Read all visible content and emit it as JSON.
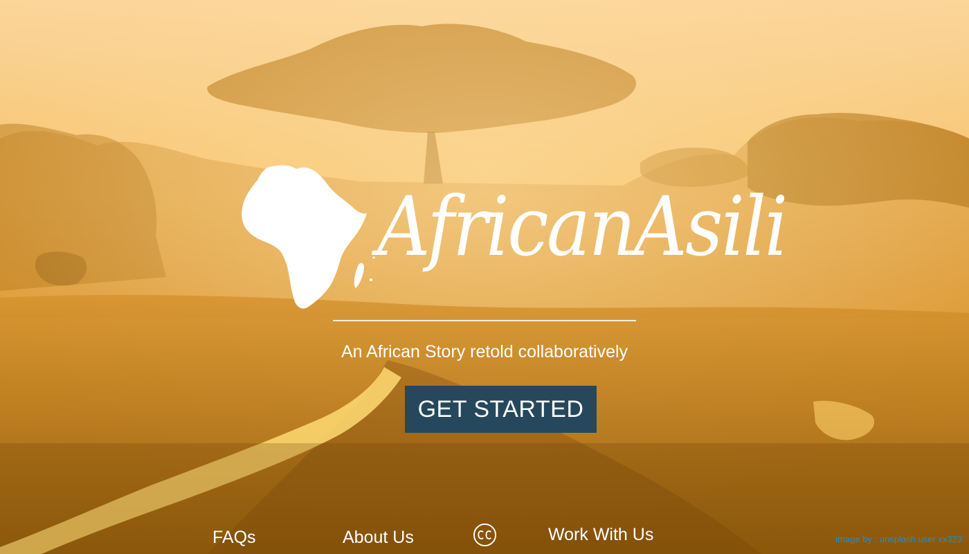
{
  "brand": {
    "name": "AfricanAsili",
    "logo_icon": "africa-map-icon"
  },
  "hero": {
    "tagline": "An African Story retold collaboratively",
    "cta_label": "GET STARTED",
    "background": "african-savanna-sunset-photo"
  },
  "footer": {
    "links": [
      {
        "label": "FAQs"
      },
      {
        "label": "About Us"
      },
      {
        "label": "Work With Us"
      }
    ],
    "license_icon": "creative-commons-icon",
    "credit": "image by : unsplash user xx323"
  },
  "colors": {
    "cta_background": "#26485c",
    "text": "#ffffff",
    "credit_link": "#1a8fd6",
    "sky_light": "#fbd9a0",
    "sky_mid": "#f3b24f",
    "ground": "#b47612"
  }
}
